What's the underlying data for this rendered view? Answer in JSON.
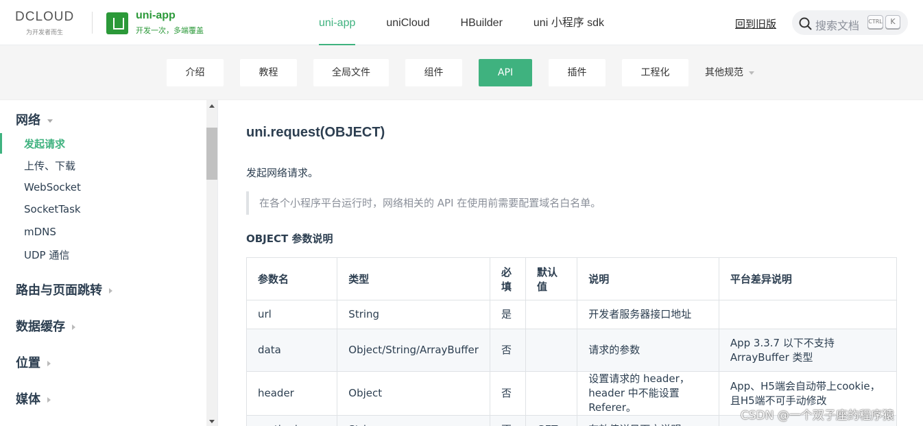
{
  "header": {
    "dcloud_wordmark": "DCLOUD",
    "dcloud_tagline": "为开发者而生",
    "app_title": "uni-app",
    "app_subtitle": "开发一次，多端覆盖",
    "nav": [
      {
        "label": "uni-app",
        "active": true
      },
      {
        "label": "uniCloud",
        "active": false
      },
      {
        "label": "HBuilder",
        "active": false
      },
      {
        "label": "uni 小程序 sdk",
        "active": false
      }
    ],
    "old_version_link": "回到旧版",
    "search_placeholder": "搜索文档",
    "kbd_ctrl": "CTRL",
    "kbd_k": "K",
    "accent_color": "#3fb27f"
  },
  "subnav": {
    "items": [
      {
        "label": "介绍"
      },
      {
        "label": "教程"
      },
      {
        "label": "全局文件"
      },
      {
        "label": "组件"
      },
      {
        "label": "API",
        "active": true
      },
      {
        "label": "插件"
      },
      {
        "label": "工程化"
      },
      {
        "label": "其他规范",
        "dropdown": true
      }
    ]
  },
  "sidebar": {
    "section_network": "网络",
    "network_items": [
      {
        "label": "发起请求",
        "active": true
      },
      {
        "label": "上传、下载"
      },
      {
        "label": "WebSocket"
      },
      {
        "label": "SocketTask"
      },
      {
        "label": "mDNS"
      },
      {
        "label": "UDP 通信"
      }
    ],
    "section_routing": "路由与页面跳转",
    "section_storage": "数据缓存",
    "section_location": "位置",
    "section_media": "媒体"
  },
  "main": {
    "title": "uni.request(OBJECT)",
    "description": "发起网络请求。",
    "tip": "在各个小程序平台运行时，网络相关的 API 在使用前需要配置域名白名单。",
    "params_heading": "OBJECT 参数说明",
    "table": {
      "headers": [
        "参数名",
        "类型",
        "必填",
        "默认值",
        "说明",
        "平台差异说明"
      ],
      "rows": [
        [
          "url",
          "String",
          "是",
          "",
          "开发者服务器接口地址",
          ""
        ],
        [
          "data",
          "Object/String/ArrayBuffer",
          "否",
          "",
          "请求的参数",
          "App 3.3.7 以下不支持 ArrayBuffer 类型"
        ],
        [
          "header",
          "Object",
          "否",
          "",
          "设置请求的 header，header 中不能设置 Referer。",
          "App、H5端会自动带上cookie，且H5端不可手动修改"
        ],
        [
          "method",
          "String",
          "否",
          "GET",
          "有效值详见下方说明",
          ""
        ]
      ]
    }
  },
  "watermark": "CSDN @一个双子座的程序猿"
}
